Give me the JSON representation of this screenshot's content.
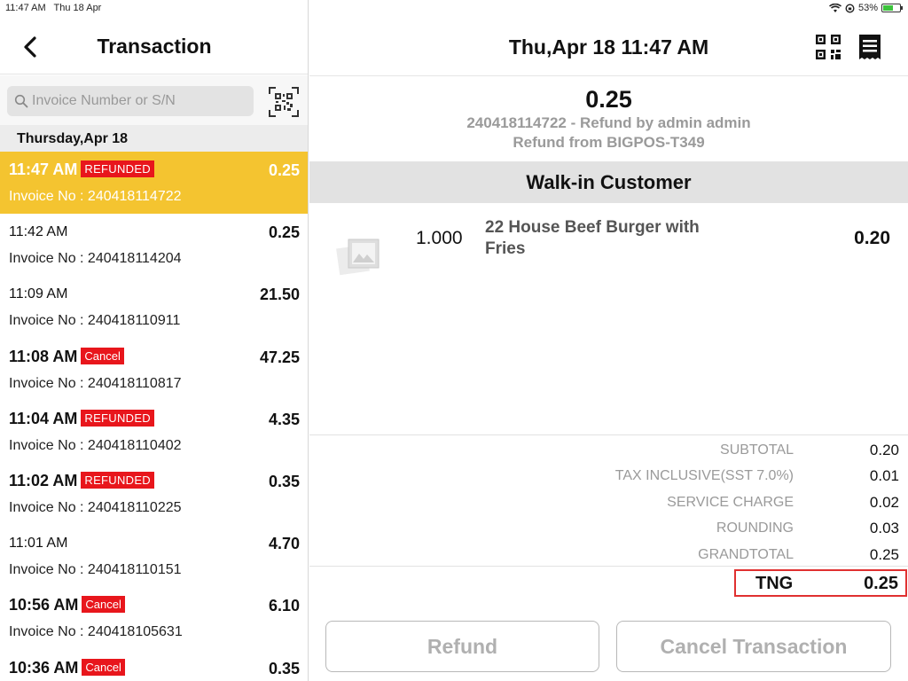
{
  "status_bar": {
    "time": "11:47 AM",
    "date": "Thu 18 Apr",
    "battery": "53%",
    "battery_level": 0.53
  },
  "left": {
    "title": "Transaction",
    "search_placeholder": "Invoice Number or S/N",
    "date_header": "Thursday,Apr 18",
    "transactions": [
      {
        "time": "11:47 AM",
        "badge": "REFUNDED",
        "amount": "0.25",
        "invoice": "Invoice No : 240418114722"
      },
      {
        "time": "11:42 AM",
        "badge": "",
        "amount": "0.25",
        "invoice": "Invoice No : 240418114204"
      },
      {
        "time": "11:09 AM",
        "badge": "",
        "amount": "21.50",
        "invoice": "Invoice No : 240418110911"
      },
      {
        "time": "11:08 AM",
        "badge": "Cancel",
        "amount": "47.25",
        "invoice": "Invoice No : 240418110817"
      },
      {
        "time": "11:04 AM",
        "badge": "REFUNDED",
        "amount": "4.35",
        "invoice": "Invoice No : 240418110402"
      },
      {
        "time": "11:02 AM",
        "badge": "REFUNDED",
        "amount": "0.35",
        "invoice": "Invoice No : 240418110225"
      },
      {
        "time": "11:01 AM",
        "badge": "",
        "amount": "4.70",
        "invoice": "Invoice No : 240418110151"
      },
      {
        "time": "10:56 AM",
        "badge": "Cancel",
        "amount": "6.10",
        "invoice": "Invoice No : 240418105631"
      },
      {
        "time": "10:36 AM",
        "badge": "Cancel",
        "amount": "0.35",
        "invoice": ""
      }
    ]
  },
  "right": {
    "title": "Thu,Apr 18 11:47 AM",
    "total": "0.25",
    "detail_line1": "240418114722 - Refund by admin admin",
    "detail_line2": "Refund from BIGPOS-T349",
    "customer": "Walk-in Customer",
    "item": {
      "qty": "1.000",
      "name": "22 House Beef Burger with Fries",
      "price": "0.20"
    },
    "totals": [
      {
        "label": "SUBTOTAL",
        "value": "0.20"
      },
      {
        "label": "TAX INCLUSIVE(SST 7.0%)",
        "value": "0.01"
      },
      {
        "label": "SERVICE CHARGE",
        "value": "0.02"
      },
      {
        "label": "ROUNDING",
        "value": "0.03"
      },
      {
        "label": "GRANDTOTAL",
        "value": "0.25"
      }
    ],
    "payment": {
      "method": "TNG",
      "amount": "0.25"
    },
    "refund_label": "Refund",
    "cancel_label": "Cancel Transaction"
  },
  "colors": {
    "selected_row": "#f4c430",
    "badge": "#e8161c",
    "payment_highlight": "#e03030"
  }
}
